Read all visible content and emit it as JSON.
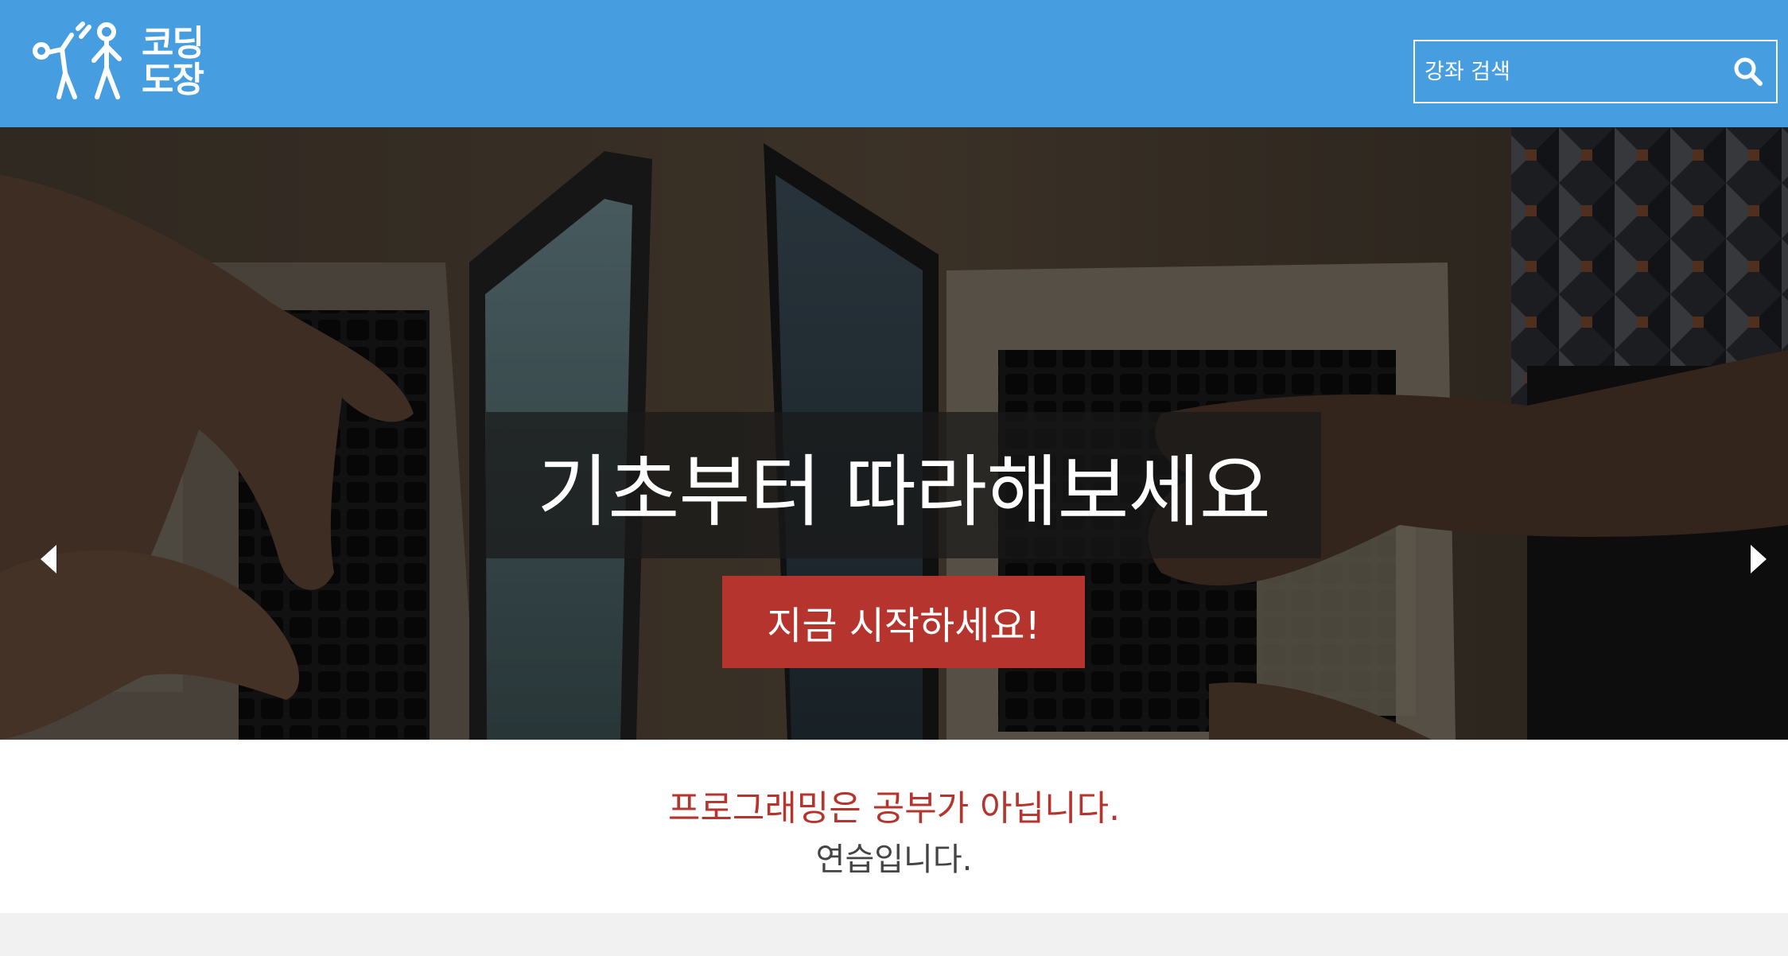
{
  "header": {
    "logo": {
      "line1": "코딩",
      "line2": "도장"
    },
    "search": {
      "placeholder": "강좌 검색",
      "icon": "search-icon"
    }
  },
  "hero": {
    "title": "기초부터 따라해보세요",
    "cta_label": "지금 시작하세요!",
    "prev_icon": "chevron-left-icon",
    "next_icon": "chevron-right-icon"
  },
  "tagline": {
    "line1": "프로그래밍은 공부가 아닙니다.",
    "line2": "연습입니다."
  },
  "colors": {
    "header_bg": "#469ee0",
    "accent_red": "#b5342e",
    "footer_band": "#f1f1f1"
  }
}
